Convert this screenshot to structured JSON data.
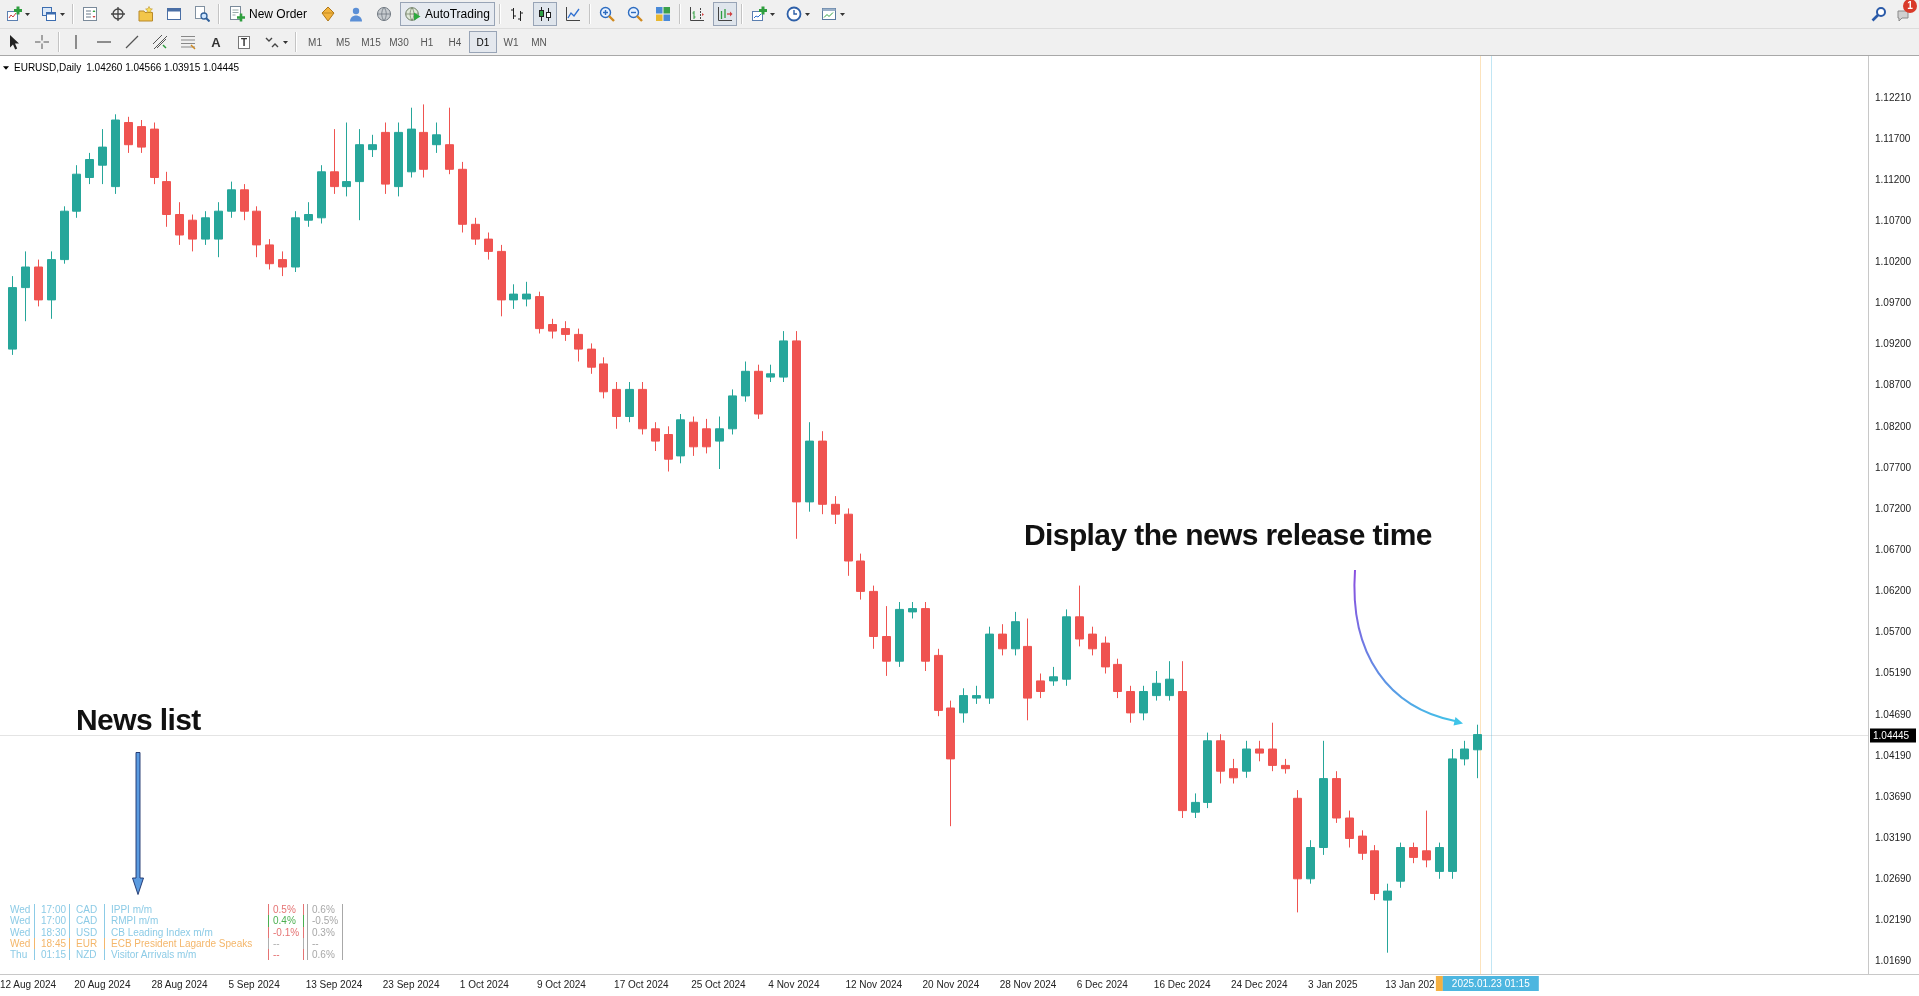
{
  "toolbar": {
    "new_order": {
      "label": "New Order"
    },
    "auto_trading": {
      "label": "AutoTrading",
      "on": true
    },
    "chart_types": [
      {
        "kind": "bars",
        "selected": false
      },
      {
        "kind": "candles",
        "selected": true
      },
      {
        "kind": "line",
        "selected": false
      }
    ],
    "view_toggles": [
      {
        "kind": "chart_shift",
        "on": false
      },
      {
        "kind": "auto_scroll",
        "on": true
      }
    ],
    "notifications": {
      "count": "1"
    }
  },
  "drawing_toolbar": {
    "text_tool": "A",
    "label_tool": "T",
    "timeframes": [
      {
        "label": "M1",
        "selected": false
      },
      {
        "label": "M5",
        "selected": false
      },
      {
        "label": "M15",
        "selected": false
      },
      {
        "label": "M30",
        "selected": false
      },
      {
        "label": "H1",
        "selected": false
      },
      {
        "label": "H4",
        "selected": false
      },
      {
        "label": "D1",
        "selected": true
      },
      {
        "label": "W1",
        "selected": false
      },
      {
        "label": "MN",
        "selected": false
      }
    ]
  },
  "chart": {
    "symbol": "EURUSD,Daily",
    "ohlc": "1.04260 1.04566 1.03915 1.04445",
    "price_axis": {
      "labels": [
        "1.12210",
        "1.11700",
        "1.11200",
        "1.10700",
        "1.10200",
        "1.09700",
        "1.09200",
        "1.08700",
        "1.08200",
        "1.07700",
        "1.07200",
        "1.06700",
        "1.06200",
        "1.05700",
        "1.05190",
        "1.04690",
        "1.04190",
        "1.03690",
        "1.03190",
        "1.02690",
        "1.02190",
        "1.01690"
      ],
      "current_price": "1.04445"
    },
    "time_axis": {
      "labels": [
        "12 Aug 2024",
        "20 Aug 2024",
        "28 Aug 2024",
        "5 Sep 2024",
        "13 Sep 2024",
        "23 Sep 2024",
        "1 Oct 2024",
        "9 Oct 2024",
        "17 Oct 2024",
        "25 Oct 2024",
        "4 Nov 2024",
        "12 Nov 2024",
        "20 Nov 2024",
        "28 Nov 2024",
        "6 Dec 2024",
        "16 Dec 2024",
        "24 Dec 2024",
        "3 Jan 2025",
        "13 Jan 202"
      ],
      "markers": [
        {
          "color": "#f5b041"
        },
        {
          "color": "#4db6e0",
          "label": "2025.01.23 01:15"
        }
      ]
    }
  },
  "news_panel": {
    "rows": [
      {
        "day": "Wed",
        "time": "17:00",
        "currency": "CAD",
        "event": "IPPI m/m",
        "forecast": {
          "text": "0.5%",
          "color": "#e57373"
        },
        "previous": "0.6%",
        "color": "#8ccbe6"
      },
      {
        "day": "Wed",
        "time": "17:00",
        "currency": "CAD",
        "event": "RMPI m/m",
        "forecast": {
          "text": "0.4%",
          "color": "#4caf50"
        },
        "previous": "-0.5%",
        "color": "#8ccbe6"
      },
      {
        "day": "Wed",
        "time": "18:30",
        "currency": "USD",
        "event": "CB Leading Index m/m",
        "forecast": {
          "text": "-0.1%",
          "color": "#e57373"
        },
        "previous": "0.3%",
        "color": "#8ccbe6"
      },
      {
        "day": "Wed",
        "time": "18:45",
        "currency": "EUR",
        "event": "ECB President Lagarde Speaks",
        "forecast": {
          "text": "--",
          "color": "#b0b0b0"
        },
        "previous": "--",
        "color": "#f4b66a"
      },
      {
        "day": "Thu",
        "time": "01:15",
        "currency": "NZD",
        "event": "Visitor Arrivals m/m",
        "forecast": {
          "text": "--",
          "color": "#e57373"
        },
        "previous": "0.6%",
        "color": "#8ccbe6"
      }
    ]
  },
  "callouts": [
    {
      "kind": "straight_arrow",
      "text": "News list"
    },
    {
      "kind": "curved_arrow",
      "text": "Display the news release time"
    }
  ]
}
